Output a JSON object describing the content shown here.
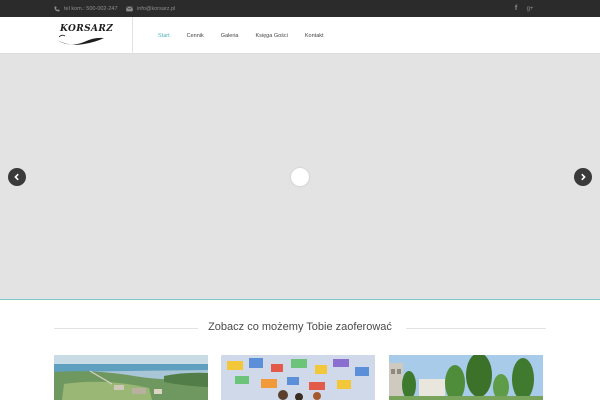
{
  "topbar": {
    "phone_text": "tel kom.: 500-002-247",
    "email_text": "info@korsarz.pl",
    "social": [
      {
        "icon": "facebook-icon",
        "glyph": "f"
      },
      {
        "icon": "google-plus-icon",
        "glyph": "g+"
      }
    ]
  },
  "header": {
    "logo_text": "KORSARZ",
    "nav": [
      {
        "label": "Start",
        "active": true
      },
      {
        "label": "Cennik",
        "active": false
      },
      {
        "label": "Galeria",
        "active": false
      },
      {
        "label": "Księga Gości",
        "active": false
      },
      {
        "label": "Kontakt",
        "active": false
      }
    ]
  },
  "slider": {
    "prev_icon": "chevron-left-icon",
    "next_icon": "chevron-right-icon",
    "loader_icon": "loading-spinner-icon"
  },
  "section": {
    "title": "Zobacz co możemy Tobie zaoferować"
  },
  "cards": [
    {
      "name": "offer-card-aerial-coast"
    },
    {
      "name": "offer-card-colorful-board"
    },
    {
      "name": "offer-card-trees-building"
    }
  ],
  "colors": {
    "topbar_bg": "#2b2b2b",
    "accent": "#4ab3b3",
    "slider_bg": "#e3e3e3",
    "arrow_bg": "#3a3a3a"
  }
}
